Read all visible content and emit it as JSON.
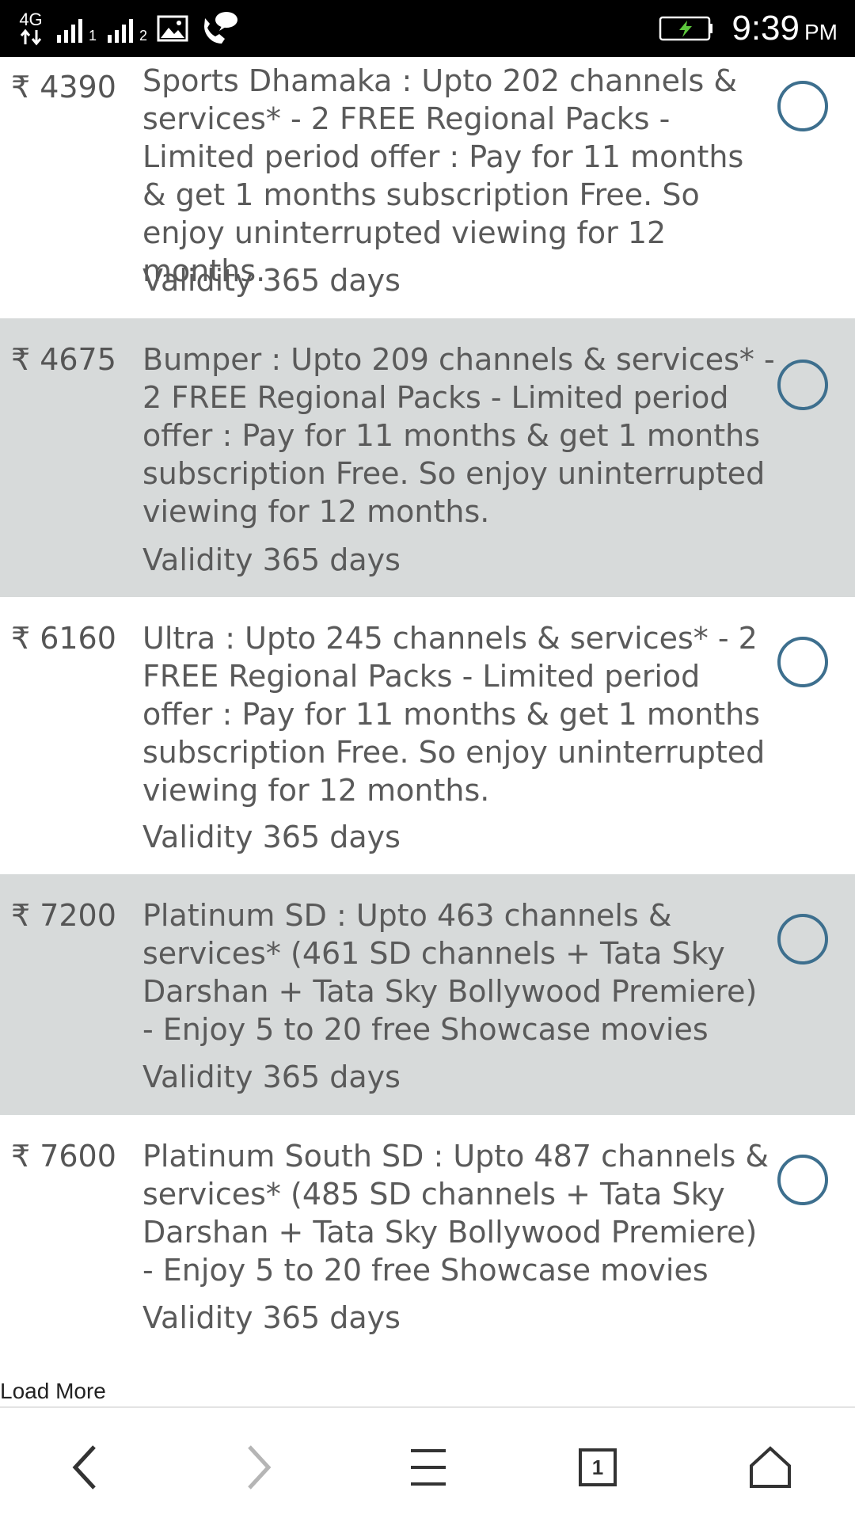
{
  "status_bar": {
    "network": "4G",
    "sim1": "1",
    "sim2": "2",
    "time": "9:39",
    "ampm": "PM",
    "icons": [
      "signal-icon",
      "gallery-icon",
      "phone-call-icon",
      "battery-charging-icon"
    ]
  },
  "plans": [
    {
      "currency": "₹",
      "price": "4390",
      "description": "Sports Dhamaka : Upto 202 channels & services* - 2 FREE Regional Packs - Limited period offer : Pay for 11 months & get 1 months subscription Free. So enjoy uninterrupted viewing for 12 months.",
      "validity": "Validity 365 days"
    },
    {
      "currency": "₹",
      "price": "4675",
      "description": "Bumper : Upto 209 channels & services* - 2 FREE Regional Packs - Limited period offer : Pay for 11 months & get 1 months subscription Free. So enjoy uninterrupted viewing for 12 months.",
      "validity": "Validity 365 days"
    },
    {
      "currency": "₹",
      "price": "6160",
      "description": "Ultra : Upto 245 channels & services* - 2 FREE Regional Packs - Limited period offer : Pay for 11 months & get 1 months subscription Free. So enjoy uninterrupted viewing for 12 months.",
      "validity": "Validity 365 days"
    },
    {
      "currency": "₹",
      "price": "7200",
      "description": "Platinum SD : Upto 463 channels & services* (461 SD channels + Tata Sky Darshan + Tata Sky Bollywood Premiere) - Enjoy 5 to 20 free Showcase movies",
      "validity": "Validity 365 days"
    },
    {
      "currency": "₹",
      "price": "7600",
      "description": "Platinum South SD : Upto 487 channels & services* (485 SD channels + Tata Sky Darshan + Tata Sky Bollywood Premiere) - Enjoy 5 to 20 free Showcase movies",
      "validity": "Validity 365 days"
    }
  ],
  "load_more": "Load More",
  "nav": {
    "tab_count": "1",
    "colors": {
      "active": "#333333",
      "disabled": "#b5b5b5"
    }
  },
  "colors": {
    "radio_border": "#3d6f8e",
    "alt_row_bg": "#d7dada",
    "text": "#5a5a5a"
  }
}
